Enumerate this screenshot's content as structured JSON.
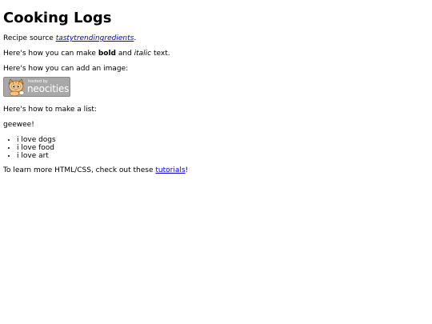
{
  "page": {
    "title": "Cooking Logs",
    "source_prefix": "Recipe source ",
    "source_link": "tastytrendingredients",
    "source_suffix": ".",
    "bold_prefix": "Here's how you can make ",
    "bold_word": "bold",
    "bold_mid": " and ",
    "italic_word": "italic",
    "bold_suffix": " text.",
    "image_text": "Here's how you can add an image:",
    "badge": {
      "hosted_by": "hosted by",
      "brand": "neocities",
      "icon": "neocities-cat-icon"
    },
    "list_intro": "Here's how to make a list:",
    "geewee": "geewee!",
    "list_items": [
      "i love dogs",
      "i love food",
      "i love art"
    ],
    "learn_prefix": "To learn more HTML/CSS, check out these ",
    "learn_link": "tutorials",
    "learn_suffix": "!"
  },
  "colors": {
    "link": "#0000ee",
    "badge_bg": "#a8a8a8",
    "text": "#000000"
  }
}
